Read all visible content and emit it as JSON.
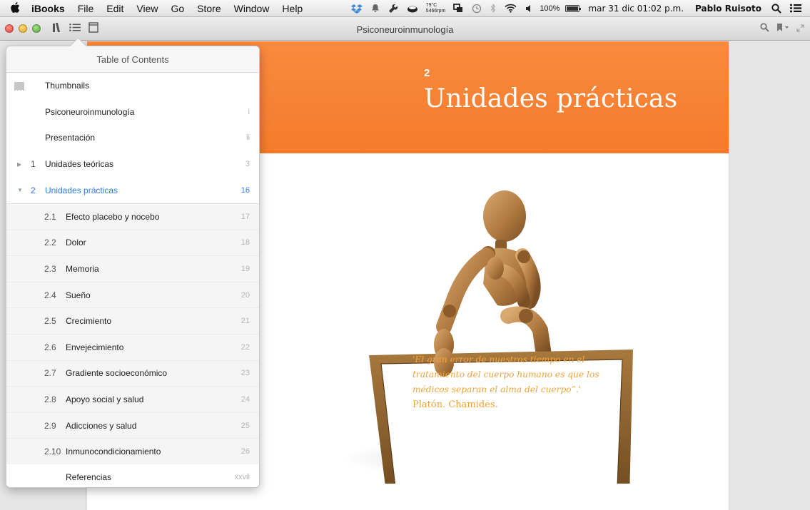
{
  "menubar": {
    "apple_icon": "apple-logo-icon",
    "app_name": "iBooks",
    "menus": [
      "File",
      "Edit",
      "View",
      "Go",
      "Store",
      "Window",
      "Help"
    ],
    "status": {
      "temp": "79°C",
      "fan": "5466rpm",
      "battery": "100%",
      "battery_level": 1.0,
      "datetime": "mar 31 dic  01:02 p.m.",
      "user": "Pablo Ruisoto"
    }
  },
  "window": {
    "title": "Psiconeuroinmunología"
  },
  "page": {
    "chapter_number": "2",
    "chapter_title": "Unidades prácticas",
    "banner_color": "#f47b2b",
    "quote": "'El gran error de nuestros tiempo en el tratamiento del cuerpo humano es que los médicos separan el alma del cuerpo”.'",
    "quote_author": "Platón. Chamides.",
    "quote_color": "#f2a33c"
  },
  "toc": {
    "title": "Table of Contents",
    "accent_color": "#2f7df0",
    "thumbnails_label": "Thumbnails",
    "top_items": [
      {
        "label": "Psiconeuroinmunología",
        "page": "i"
      },
      {
        "label": "Presentación",
        "page": "ii"
      }
    ],
    "chapter1": {
      "num": "1",
      "label": "Unidades teóricas",
      "page": "3"
    },
    "chapter2": {
      "num": "2",
      "label": "Unidades prácticas",
      "page": "16"
    },
    "sections": [
      {
        "num": "2.1",
        "label": "Efecto placebo y nocebo",
        "page": "17"
      },
      {
        "num": "2.2",
        "label": "Dolor",
        "page": "18"
      },
      {
        "num": "2.3",
        "label": "Memoria",
        "page": "19"
      },
      {
        "num": "2.4",
        "label": "Sueño",
        "page": "20"
      },
      {
        "num": "2.5",
        "label": "Crecimiento",
        "page": "21"
      },
      {
        "num": "2.6",
        "label": "Envejecimiento",
        "page": "22"
      },
      {
        "num": "2.7",
        "label": "Gradiente socioeconómico",
        "page": "23"
      },
      {
        "num": "2.8",
        "label": "Apoyo social y salud",
        "page": "24"
      },
      {
        "num": "2.9",
        "label": "Adicciones y salud",
        "page": "25"
      },
      {
        "num": "2.10",
        "label": "Inmunocondicionamiento",
        "page": "26"
      }
    ],
    "references": {
      "label": "Referencias",
      "page": "xxvii"
    }
  }
}
